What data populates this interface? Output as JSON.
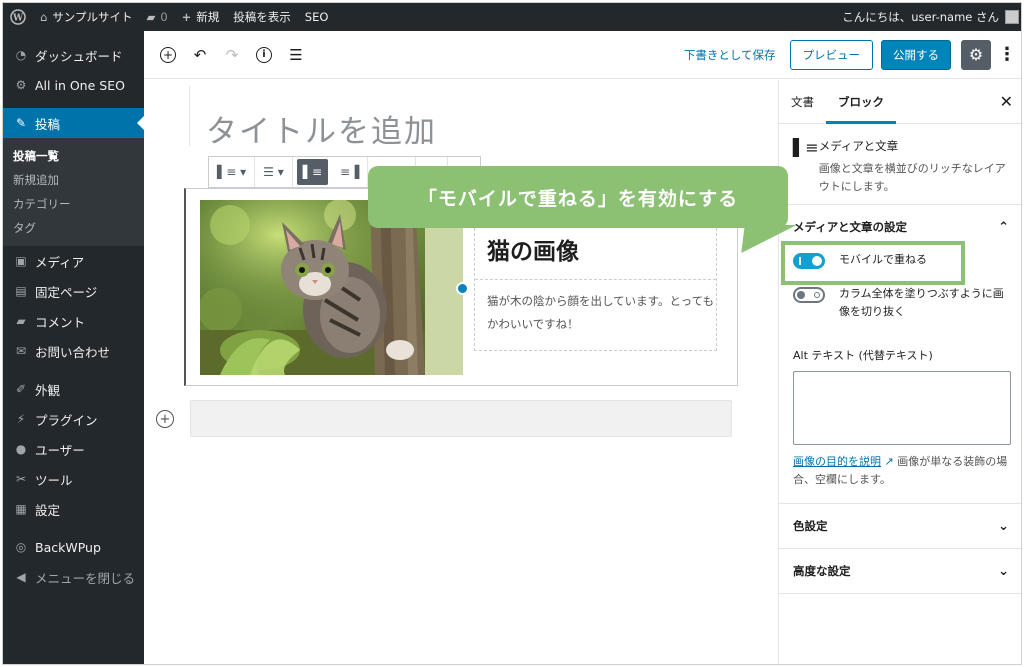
{
  "adminbar": {
    "wp_logo": "wordpress-icon",
    "site_name": "サンプルサイト",
    "comments_count": "0",
    "new_label": "新規",
    "view_post": "投稿を表示",
    "seo": "SEO",
    "greeting": "こんにちは、user-name さん"
  },
  "sidebar": {
    "dashboard": "ダッシュボード",
    "aioseo": "All in One SEO",
    "posts": "投稿",
    "posts_sub": [
      "投稿一覧",
      "新規追加",
      "カテゴリー",
      "タグ"
    ],
    "media": "メディア",
    "pages": "固定ページ",
    "comments": "コメント",
    "contact": "お問い合わせ",
    "appearance": "外観",
    "plugins": "プラグイン",
    "users": "ユーザー",
    "tools": "ツール",
    "settings": "設定",
    "backwpup": "BackWPup",
    "collapse": "メニューを閉じる"
  },
  "header": {
    "save_draft": "下書きとして保存",
    "preview": "プレビュー",
    "publish": "公開する"
  },
  "editor": {
    "title_placeholder": "タイトルを追加",
    "heading": "猫の画像",
    "paragraph": "猫が木の陰から顔を出しています。とってもかわいいですね！"
  },
  "panel": {
    "tab_document": "文書",
    "tab_block": "ブロック",
    "block_name": "メディアと文章",
    "block_desc": "画像と文章を横並びのリッチなレイアウトにします。",
    "section_title": "メディアと文章の設定",
    "toggle_stack": "モバイルで重ねる",
    "toggle_crop": "カラム全体を塗りつぶすように画像を切り抜く",
    "alt_label": "Alt テキスト (代替テキスト)",
    "alt_value": "",
    "alt_link": "画像の目的を説明",
    "alt_help": "画像が単なる装飾の場合、空欄にします。",
    "color_settings": "色設定",
    "advanced": "高度な設定"
  },
  "callout": {
    "text": "「モバイルで重ねる」を有効にする",
    "color": "#8cc072"
  }
}
